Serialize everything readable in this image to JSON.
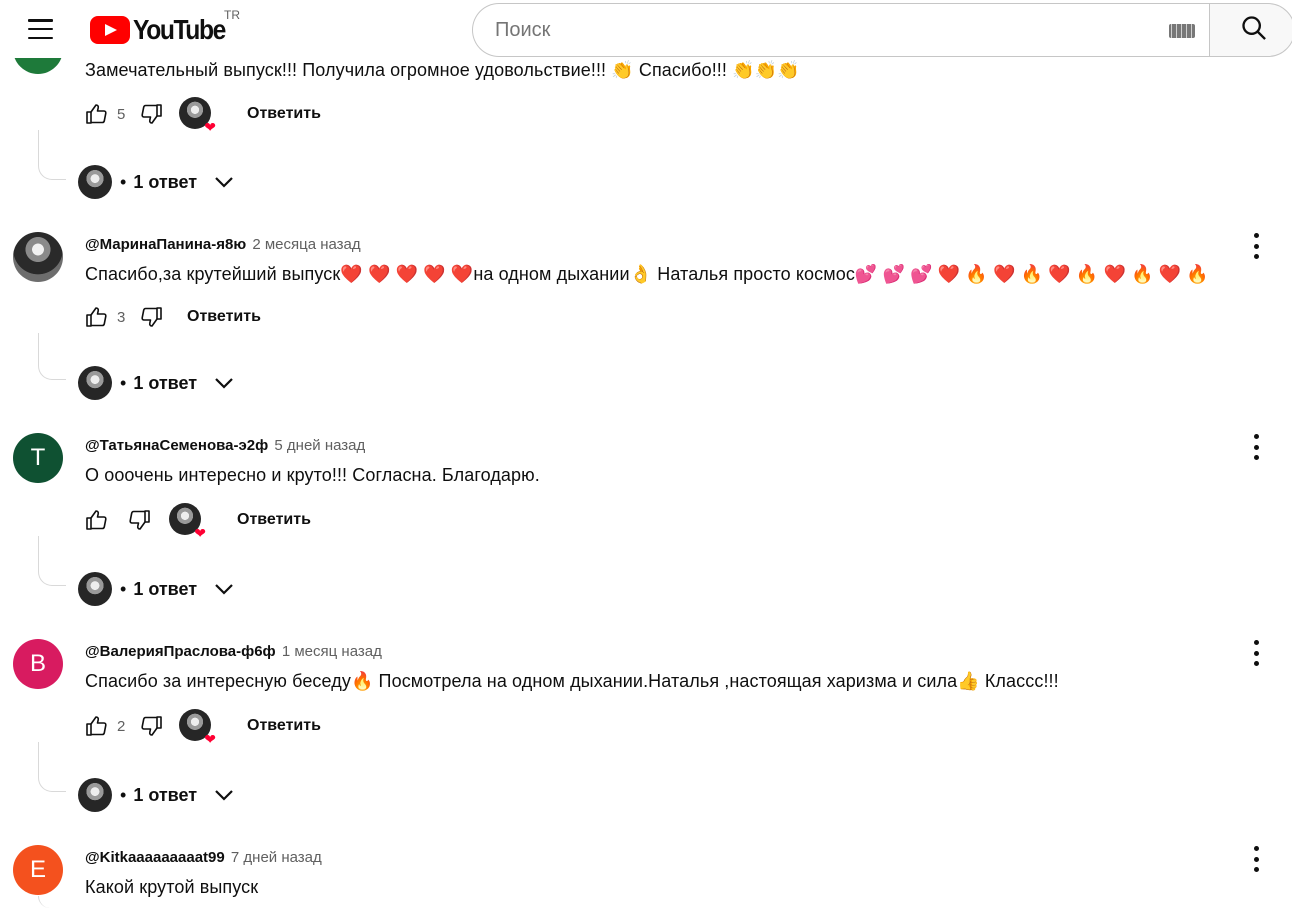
{
  "header": {
    "logo_text": "YouTube",
    "country_code": "TR",
    "search_placeholder": "Поиск"
  },
  "comments": [
    {
      "author": "",
      "time": "",
      "text": "Замечательный выпуск!!! Получила огромное удовольствие!!! 👏 Спасибо!!! 👏👏👏",
      "likes": "5",
      "creator_heart": true,
      "reply_label": "Ответить",
      "replies_label": "1 ответ",
      "avatar_color": "#1e7a3a"
    },
    {
      "author": "@МаринаПанина-я8ю",
      "time": "2 месяца назад",
      "text": "Спасибо,за крутейший выпуск❤️ ❤️ ❤️ ❤️ ❤️на одном дыхании👌 Наталья просто космос💕 💕 💕 ❤️ 🔥 ❤️ 🔥 ❤️ 🔥 ❤️ 🔥 ❤️ 🔥",
      "likes": "3",
      "creator_heart": false,
      "reply_label": "Ответить",
      "replies_label": "1 ответ",
      "avatar_letter": "",
      "avatar_color": "photo"
    },
    {
      "author": "@ТатьянаСеменова-э2ф",
      "time": "5 дней назад",
      "text": "О ооочень интересно и круто!!! Согласна. Благодарю.",
      "likes": "",
      "creator_heart": true,
      "reply_label": "Ответить",
      "replies_label": "1 ответ",
      "avatar_letter": "Т",
      "avatar_color": "#0f5132"
    },
    {
      "author": "@ВалерияПраслова-ф6ф",
      "time": "1 месяц назад",
      "text": "Спасибо за интересную беседу🔥 Посмотрела на одном дыхании.Наталья ,настоящая  харизма и сила👍 Классс!!!",
      "likes": "2",
      "creator_heart": true,
      "reply_label": "Ответить",
      "replies_label": "1 ответ",
      "avatar_letter": "В",
      "avatar_color": "#d81b60"
    },
    {
      "author": "@Kitkaaaaaaaaat99",
      "time": "7 дней назад",
      "text": "Какой крутой выпуск",
      "avatar_letter": "E",
      "avatar_color": "#f4511e"
    }
  ]
}
